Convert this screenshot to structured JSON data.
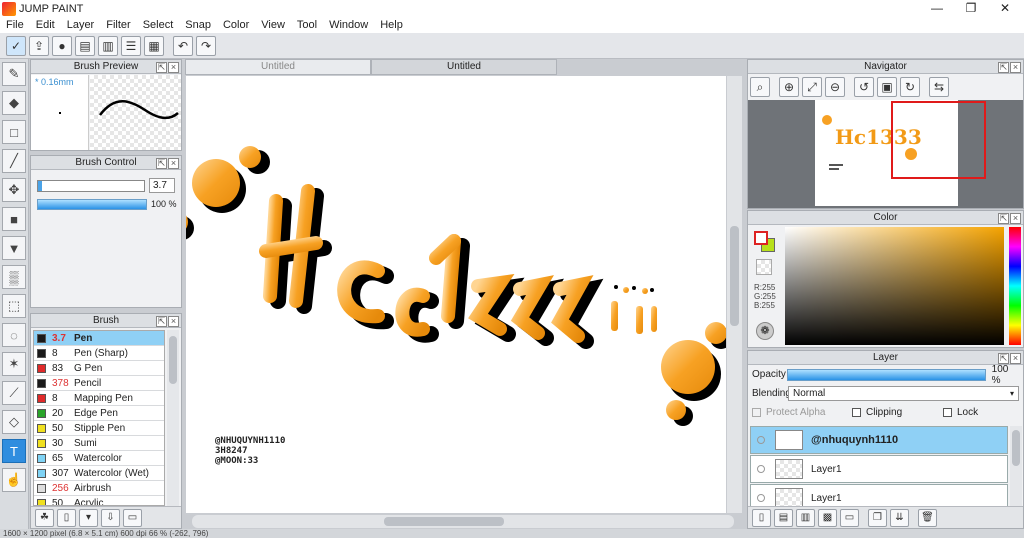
{
  "app": {
    "title": "JUMP PAINT"
  },
  "menu": [
    "File",
    "Edit",
    "Layer",
    "Filter",
    "Select",
    "Snap",
    "Color",
    "View",
    "Tool",
    "Window",
    "Help"
  ],
  "tabs": [
    {
      "label": "Untitled",
      "active": false
    },
    {
      "label": "Untitled",
      "active": true
    }
  ],
  "brush_preview": {
    "title": "Brush Preview",
    "size_label": "* 0.16mm"
  },
  "brush_control": {
    "title": "Brush Control",
    "size_value": "3.7",
    "opacity_value": "100 %"
  },
  "brush_list": {
    "title": "Brush",
    "items": [
      {
        "size": "3.7",
        "name": "Pen",
        "color": "#1a1a1a",
        "selected": true,
        "size_color": "#d33"
      },
      {
        "size": "8",
        "name": "Pen (Sharp)",
        "color": "#1a1a1a"
      },
      {
        "size": "83",
        "name": "G Pen",
        "color": "#e02a2a"
      },
      {
        "size": "378",
        "name": "Pencil",
        "color": "#1a1a1a",
        "size_color": "#d33"
      },
      {
        "size": "8",
        "name": "Mapping Pen",
        "color": "#e02a2a"
      },
      {
        "size": "20",
        "name": "Edge Pen",
        "color": "#2aa52a"
      },
      {
        "size": "50",
        "name": "Stipple Pen",
        "color": "#f0e020"
      },
      {
        "size": "30",
        "name": "Sumi",
        "color": "#f0e020"
      },
      {
        "size": "65",
        "name": "Watercolor",
        "color": "#7fd3f5"
      },
      {
        "size": "307",
        "name": "Watercolor (Wet)",
        "color": "#7fd3f5"
      },
      {
        "size": "256",
        "name": "Airbrush",
        "color": "#dddddd",
        "size_color": "#d33"
      },
      {
        "size": "50",
        "name": "Acrylic",
        "color": "#f0e020"
      }
    ]
  },
  "canvas": {
    "artwork_text": "Hc1333",
    "credit_lines": [
      "@NHUQUYNH1110",
      "3H8247",
      "@MOON:33"
    ]
  },
  "navigator": {
    "title": "Navigator"
  },
  "color": {
    "title": "Color",
    "readout_r": "R:255",
    "readout_g": "G:255",
    "readout_b": "B:255"
  },
  "layer": {
    "title": "Layer",
    "opacity_label": "Opacity",
    "opacity_value": "100 %",
    "blending_label": "Blending",
    "blending_value": "Normal",
    "protect_alpha": "Protect Alpha",
    "clipping": "Clipping",
    "lock": "Lock",
    "layers": [
      {
        "name": "@nhuquynh1110",
        "selected": true
      },
      {
        "name": "Layer1"
      },
      {
        "name": "Layer1"
      }
    ]
  },
  "status": {
    "text": "1600 × 1200 pixel (6.8 × 5.1 cm) 600 dpi 66 % (-262, 796)"
  }
}
